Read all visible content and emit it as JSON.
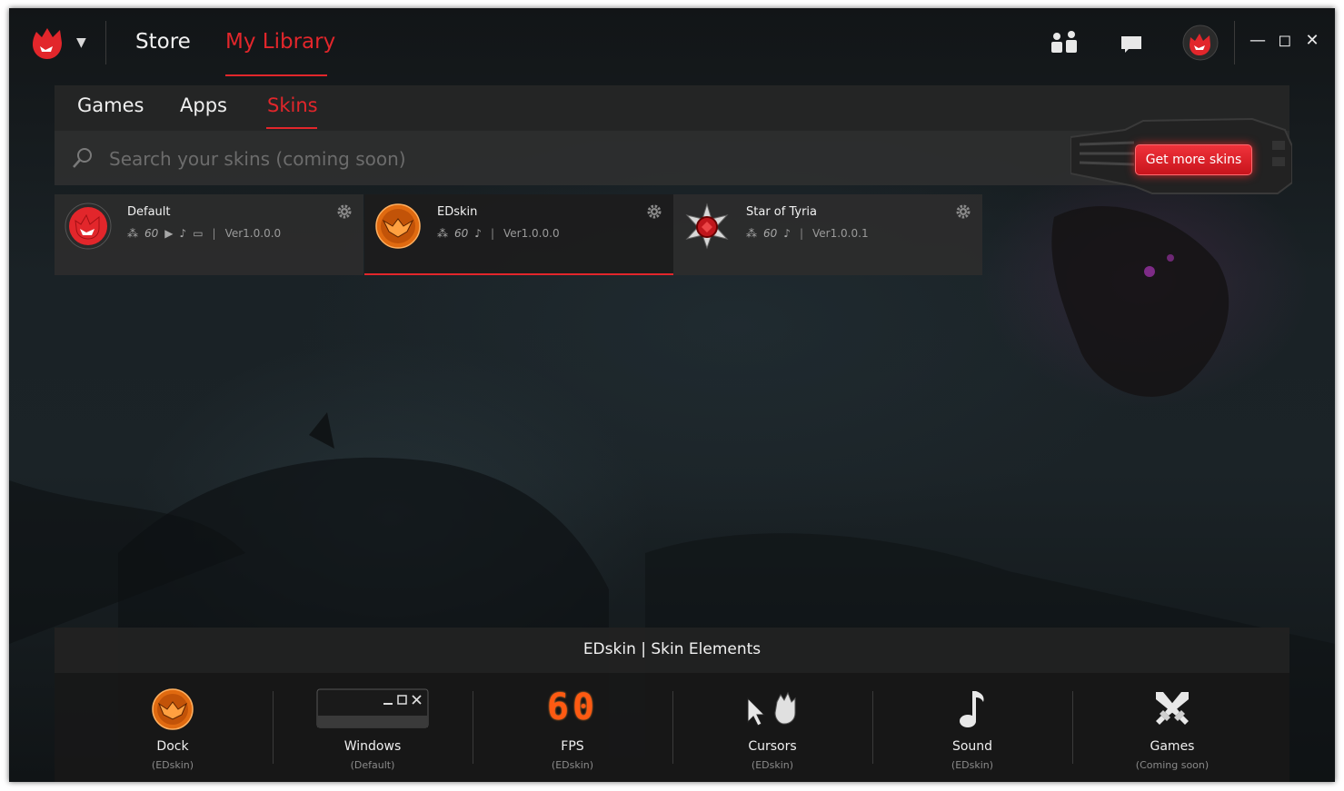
{
  "titlebar": {
    "nav": {
      "store": "Store",
      "my_library": "My Library"
    }
  },
  "tabs": [
    {
      "label": "Games"
    },
    {
      "label": "Apps"
    },
    {
      "label": "Skins"
    }
  ],
  "search": {
    "placeholder": "Search your skins (coming soon)"
  },
  "more_skins": {
    "label": "Get more skins"
  },
  "skins": [
    {
      "name": "Default",
      "version": "Ver1.0.0.0",
      "icons": [
        "dock-icon",
        "fps-icon",
        "cursor-icon",
        "sound-icon",
        "window-icon"
      ]
    },
    {
      "name": "EDskin",
      "version": "Ver1.0.0.0",
      "icons": [
        "dock-icon",
        "fps-icon",
        "sound-icon"
      ]
    },
    {
      "name": "Star of Tyria",
      "version": "Ver1.0.0.1",
      "icons": [
        "dock-icon",
        "fps-icon",
        "sound-icon"
      ]
    }
  ],
  "elements": {
    "title_skin": "EDskin",
    "title_sep": "|",
    "title_rest": "Skin Elements",
    "items": [
      {
        "label": "Dock",
        "sub": "(EDskin)"
      },
      {
        "label": "Windows",
        "sub": "(Default)"
      },
      {
        "label": "FPS",
        "sub": "(EDskin)",
        "value": "60"
      },
      {
        "label": "Cursors",
        "sub": "(EDskin)"
      },
      {
        "label": "Sound",
        "sub": "(EDskin)"
      },
      {
        "label": "Games",
        "sub": "(Coming soon)"
      }
    ]
  },
  "colors": {
    "accent": "#e2262b",
    "fps": "#ff5a12",
    "edskin_orange": "#e06a10"
  }
}
